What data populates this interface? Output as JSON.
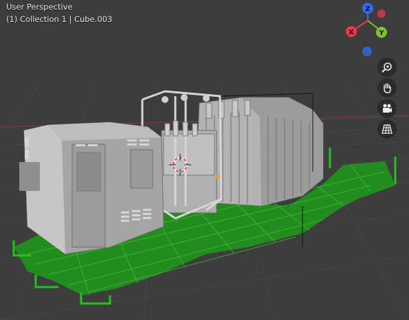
{
  "viewport": {
    "perspective_label": "User Perspective",
    "object_label": "(1) Collection 1 | Cube.003"
  },
  "gizmo": {
    "axes": [
      {
        "label": "Z",
        "color": "#2f6df2"
      },
      {
        "label": "X",
        "color": "#e8384f"
      },
      {
        "label": "Y",
        "color": "#7ec42d"
      }
    ],
    "negative_x_color": "#e8384f",
    "negative_z_color": "#2f6df2"
  },
  "nav_buttons": [
    {
      "name": "zoom-button",
      "icon": "zoom-in-icon"
    },
    {
      "name": "pan-button",
      "icon": "hand-icon"
    },
    {
      "name": "camera-view-button",
      "icon": "camera-icon"
    },
    {
      "name": "perspective-toggle-button",
      "icon": "grid-icon"
    }
  ],
  "colors": {
    "background": "#3d3d3d",
    "model_gray": "#a9a9a9",
    "selection_green": "#1f9a1a",
    "origin_orange": "#ff9a2e"
  }
}
